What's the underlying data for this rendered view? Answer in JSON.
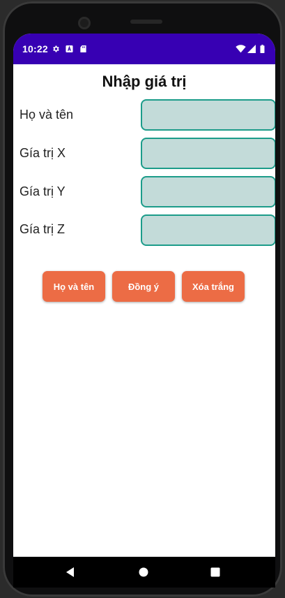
{
  "status_bar": {
    "time": "10:22",
    "left_icons": [
      "gear-icon",
      "a-notification-icon",
      "sd-card-icon"
    ],
    "right_icons": [
      "wifi-icon",
      "signal-icon",
      "battery-icon"
    ],
    "color": "#3700b3"
  },
  "screen": {
    "title": "Nhập giá trị",
    "rows": [
      {
        "label": "Họ và tên",
        "value": "",
        "placeholder": ""
      },
      {
        "label": "Gía trị X",
        "value": "",
        "placeholder": ""
      },
      {
        "label": "Gía trị Y",
        "value": "",
        "placeholder": ""
      },
      {
        "label": "Gía trị Z",
        "value": "",
        "placeholder": ""
      }
    ],
    "buttons": [
      {
        "label": "Họ và tên"
      },
      {
        "label": "Đồng ý"
      },
      {
        "label": "Xóa trắng"
      }
    ],
    "colors": {
      "button": "#ec6c45",
      "input_fill": "#c3dbd9",
      "input_border": "#1c9c8a"
    }
  },
  "nav_bar": {
    "icons": [
      "back-icon",
      "home-icon",
      "recents-icon"
    ]
  }
}
